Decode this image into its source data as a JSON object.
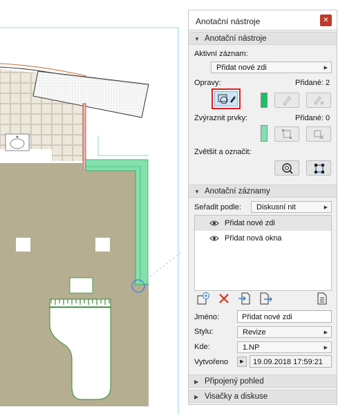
{
  "canvas": {
    "floor_color": "#b5ae90",
    "wall_highlight_color": "#6fdca0"
  },
  "palette": {
    "title": "Anotační nástroje",
    "close_icon": "close-icon",
    "section_tools": {
      "header": "Anotační nástroje",
      "active_record_label": "Aktivní záznam:",
      "active_record_value": "Přidat nové zdi",
      "fixes_label": "Opravy:",
      "fixes_added": "Přidané: 2",
      "fixes_color": "#1dbf66",
      "highlight_label": "Zvýraznit prvky:",
      "highlight_added": "Přidané: 0",
      "highlight_color": "#7fe0b0",
      "zoom_mark_label": "Zvětšit a označit:"
    },
    "section_records": {
      "header": "Anotační záznamy",
      "sort_label": "Seřadit podle:",
      "sort_value": "Diskusní nit",
      "items": [
        {
          "label": "Přidat nové zdi",
          "selected": true
        },
        {
          "label": "Přidat nová okna",
          "selected": false
        }
      ],
      "name_label": "Jméno:",
      "name_value": "Přidat nové zdi",
      "style_label": "Stylu:",
      "style_value": "Revize",
      "where_label": "Kde:",
      "where_value": "1.NP",
      "created_label": "Vytvořeno",
      "created_value": "19.09.2018 17:59:21"
    },
    "section_linked_view": {
      "header": "Připojený pohled"
    },
    "section_tags": {
      "header": "Visačky a diskuse"
    }
  }
}
